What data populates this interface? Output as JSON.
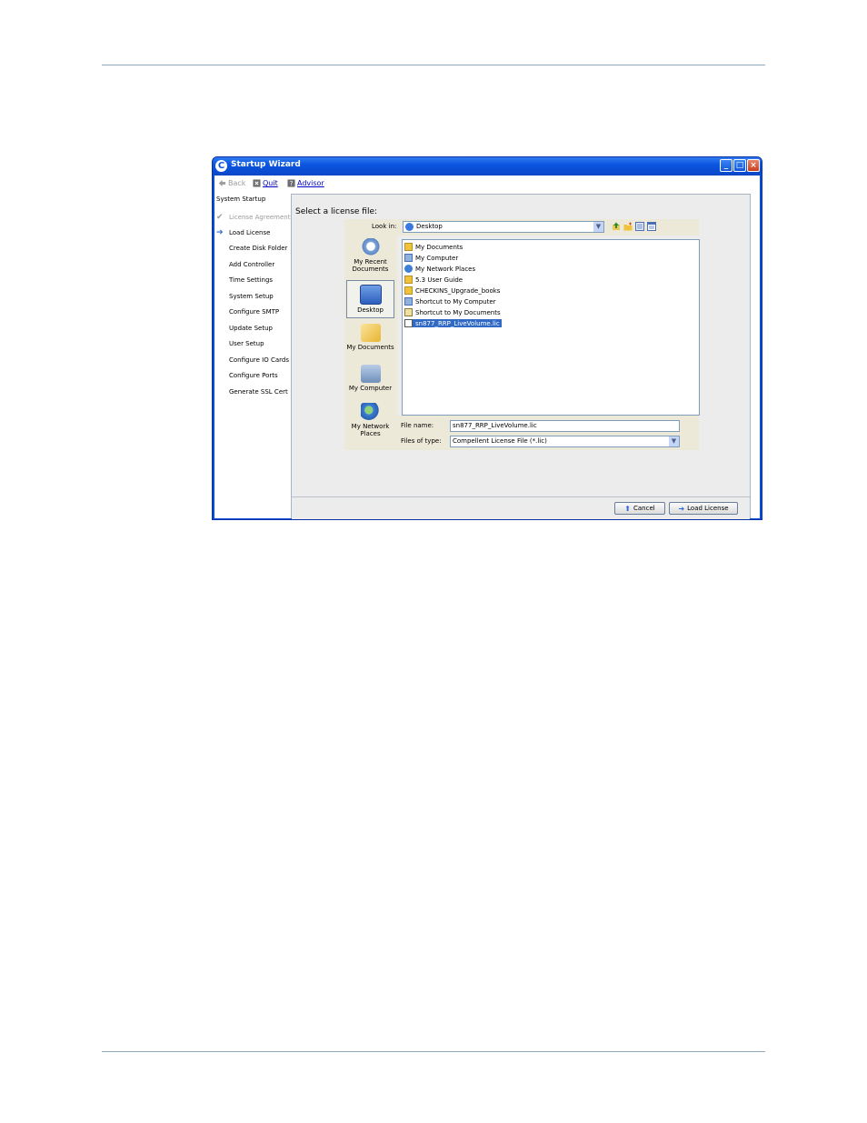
{
  "window": {
    "title": "Startup Wizard",
    "logo_letter": "C",
    "controls": {
      "minimize": "_",
      "maximize": "□",
      "close": "×"
    }
  },
  "toolbar": {
    "back_label": "Back",
    "quit_label": "Quit",
    "advisor_label": "Advisor"
  },
  "steps": {
    "header": "System Startup",
    "items": [
      {
        "label": "License Agreement",
        "state": "done"
      },
      {
        "label": "Load License",
        "state": "current"
      },
      {
        "label": "Create Disk Folder",
        "state": "pending"
      },
      {
        "label": "Add Controller",
        "state": "pending"
      },
      {
        "label": "Time Settings",
        "state": "pending"
      },
      {
        "label": "System Setup",
        "state": "pending"
      },
      {
        "label": "Configure SMTP",
        "state": "pending"
      },
      {
        "label": "Update Setup",
        "state": "pending"
      },
      {
        "label": "User Setup",
        "state": "pending"
      },
      {
        "label": "Configure IO Cards",
        "state": "pending"
      },
      {
        "label": "Configure Ports",
        "state": "pending"
      },
      {
        "label": "Generate SSL Cert",
        "state": "pending"
      }
    ]
  },
  "panel": {
    "title": "Select a license file:"
  },
  "file_chooser": {
    "look_in_label": "Look in:",
    "look_in_value": "Desktop",
    "places": [
      {
        "label": "My Recent Documents",
        "icon": "recent-documents-icon"
      },
      {
        "label": "Desktop",
        "icon": "desktop-icon",
        "selected": true
      },
      {
        "label": "My Documents",
        "icon": "my-documents-icon"
      },
      {
        "label": "My Computer",
        "icon": "my-computer-icon"
      },
      {
        "label": "My Network Places",
        "icon": "network-places-icon"
      }
    ],
    "files": [
      {
        "name": "My Documents",
        "icon": "folder-icon"
      },
      {
        "name": "My Computer",
        "icon": "computer-icon"
      },
      {
        "name": "My Network Places",
        "icon": "network-icon"
      },
      {
        "name": "5.3 User Guide",
        "icon": "folder-icon"
      },
      {
        "name": "CHECKINS_Upgrade_books",
        "icon": "folder-icon"
      },
      {
        "name": "Shortcut to My Computer",
        "icon": "shortcut-icon"
      },
      {
        "name": "Shortcut to My Documents",
        "icon": "shortcut-icon"
      },
      {
        "name": "sn877_RRP_LiveVolume.lic",
        "icon": "license-file-icon",
        "selected": true
      }
    ],
    "file_name_label": "File name:",
    "file_name_value": "sn877_RRP_LiveVolume.lic",
    "file_type_label": "Files of type:",
    "file_type_value": "Compellent License File (*.lic)"
  },
  "footer": {
    "cancel_label": "Cancel",
    "load_license_label": "Load License"
  },
  "colors": {
    "title_bar": "#0b55e0",
    "selection": "#316ac5",
    "link": "#0000cc",
    "rule": "#8fa7bd"
  }
}
